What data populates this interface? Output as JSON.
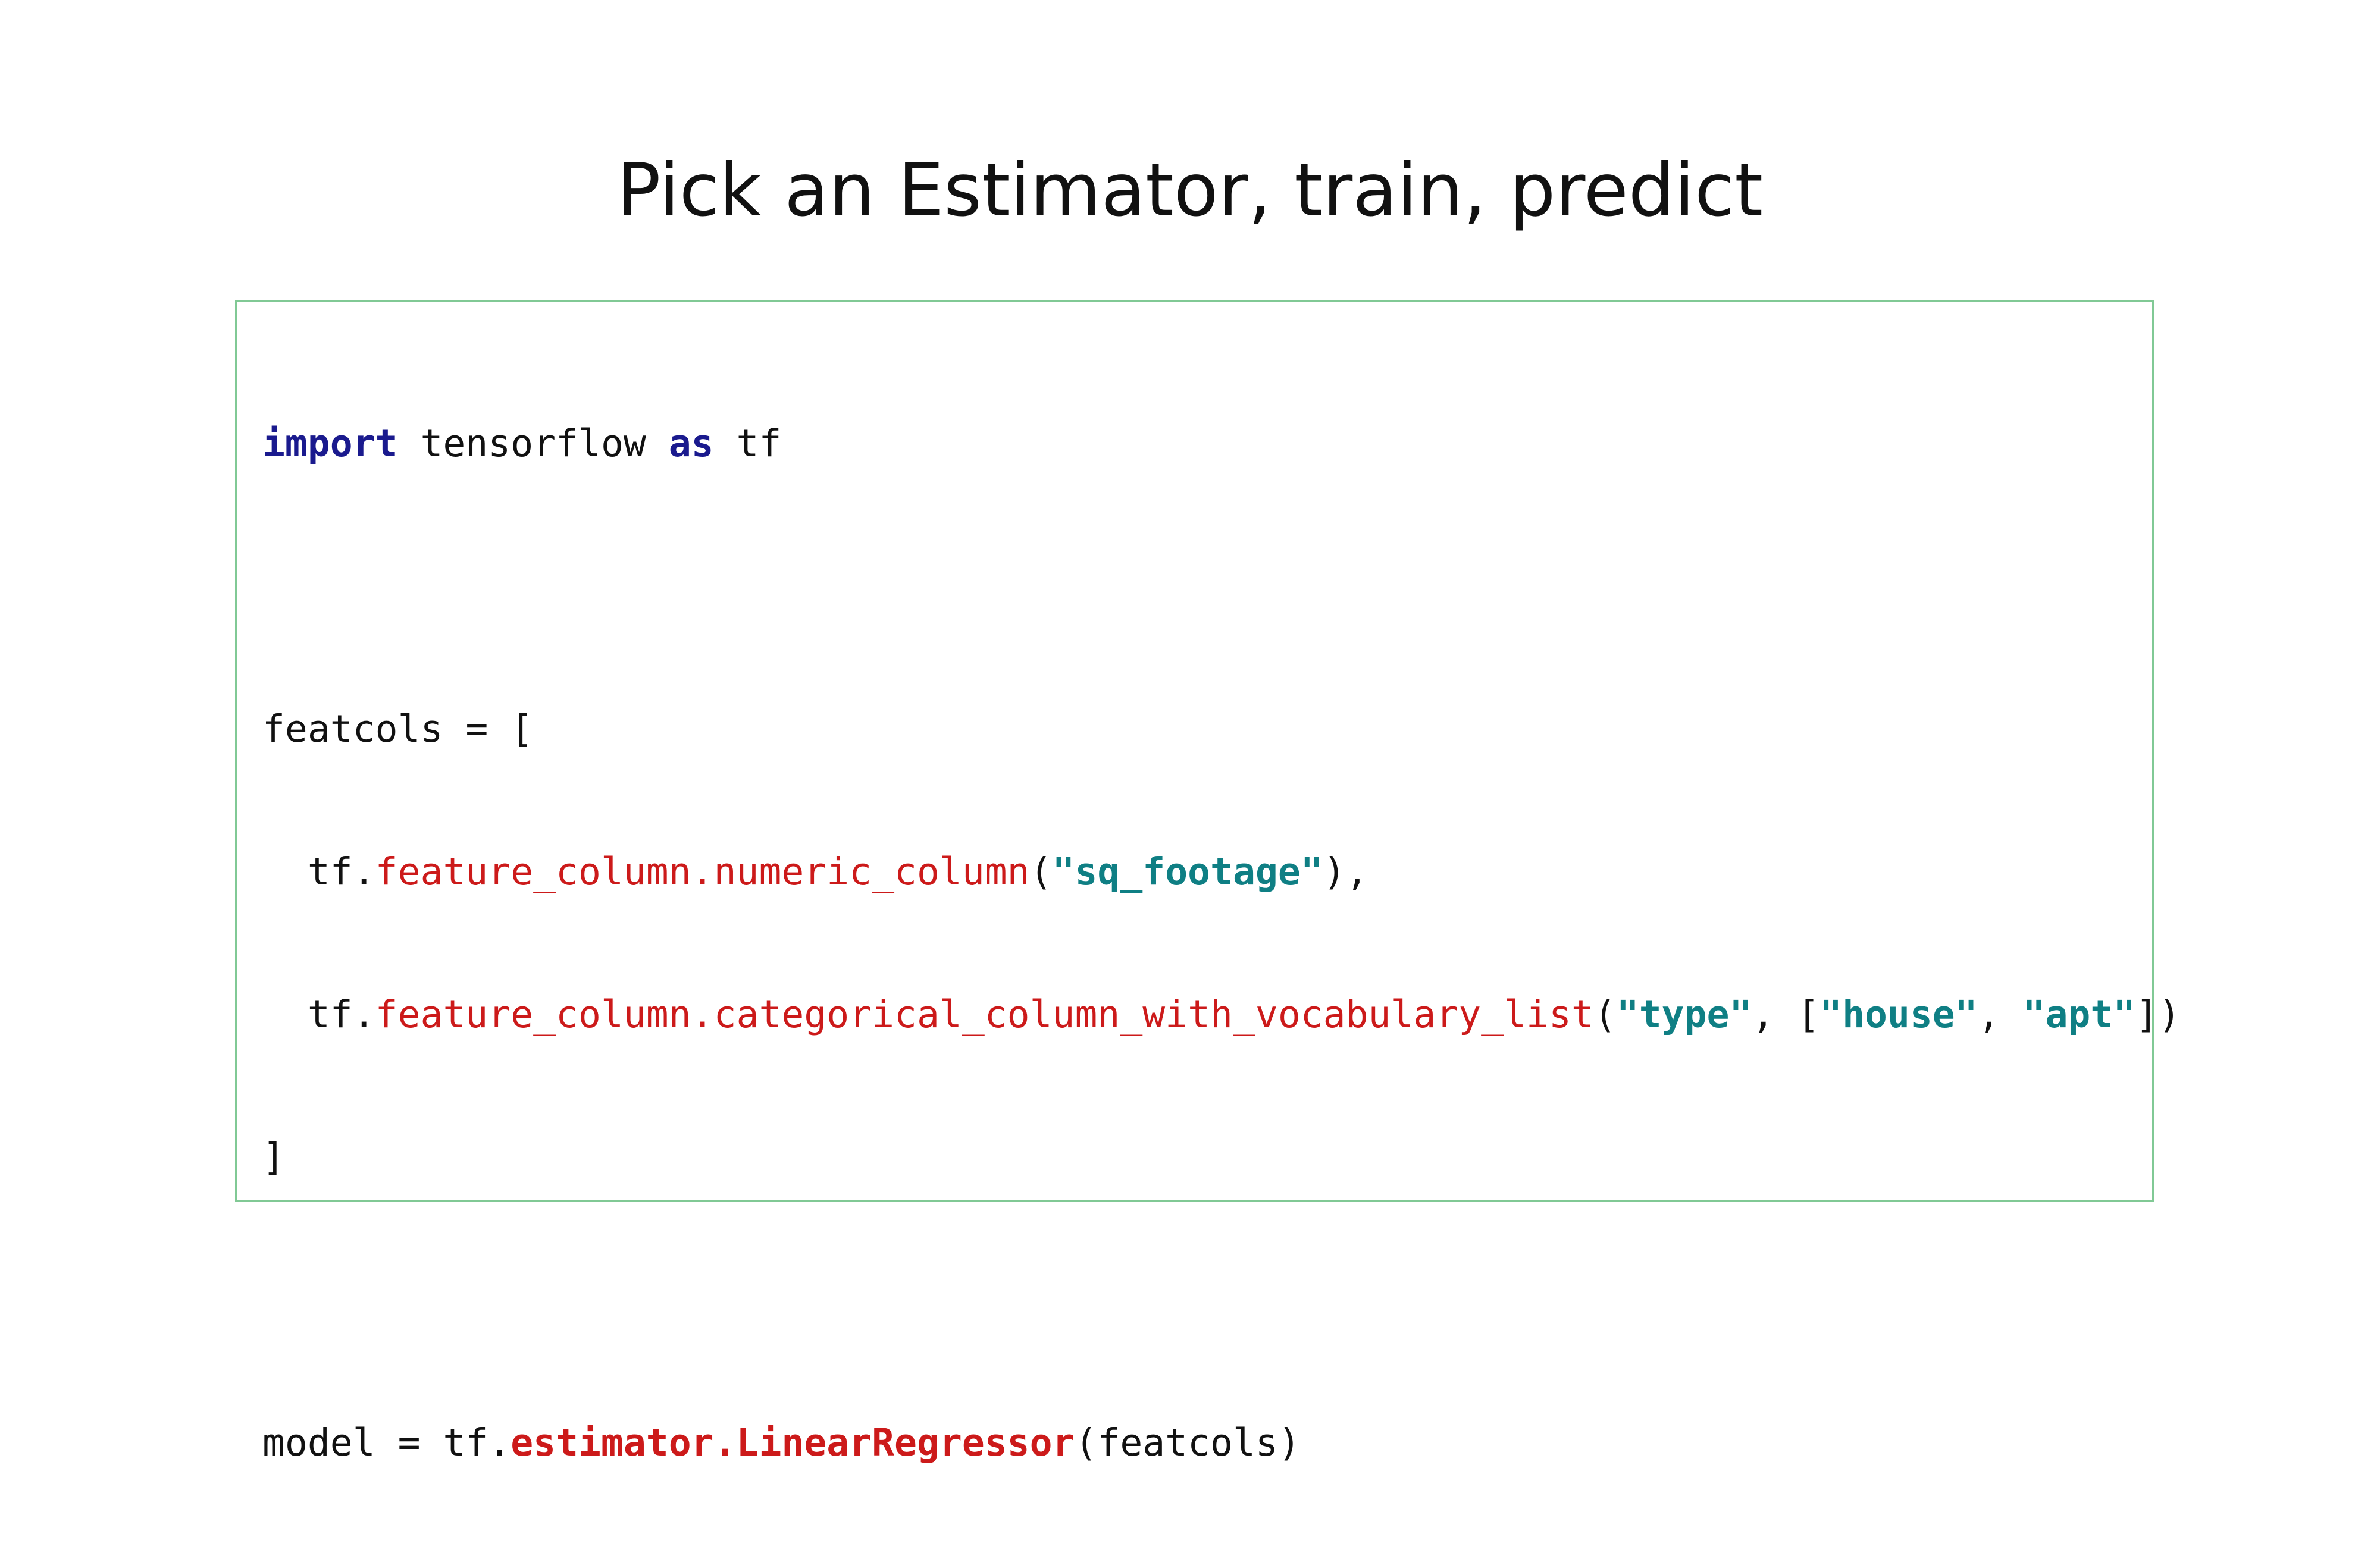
{
  "slide": {
    "title": "Pick an Estimator, train, predict"
  },
  "code": {
    "line1": {
      "kw_import": "import",
      "module": " tensorflow ",
      "kw_as": "as",
      "alias": " tf"
    },
    "line3": {
      "text": "featcols = ["
    },
    "line4": {
      "indent_prefix": "  tf.",
      "call": "feature_column.numeric_column",
      "open": "(",
      "arg": "\"sq_footage\"",
      "close": "),"
    },
    "line5": {
      "indent_prefix": "  tf.",
      "call": "feature_column.categorical_column_with_vocabulary_list",
      "open": "(",
      "arg1": "\"type\"",
      "sep1": ", [",
      "arg2": "\"house\"",
      "sep2": ", ",
      "arg3": "\"apt\"",
      "close": "])"
    },
    "line6": {
      "text": "]"
    },
    "line8": {
      "prefix": "model = tf.",
      "call": "estimator.LinearRegressor",
      "suffix": "(featcols)"
    }
  },
  "colors": {
    "keyword": "#1a1a8e",
    "function": "#cc1a1a",
    "string": "#0f7f84",
    "box_border": "#81c995"
  }
}
